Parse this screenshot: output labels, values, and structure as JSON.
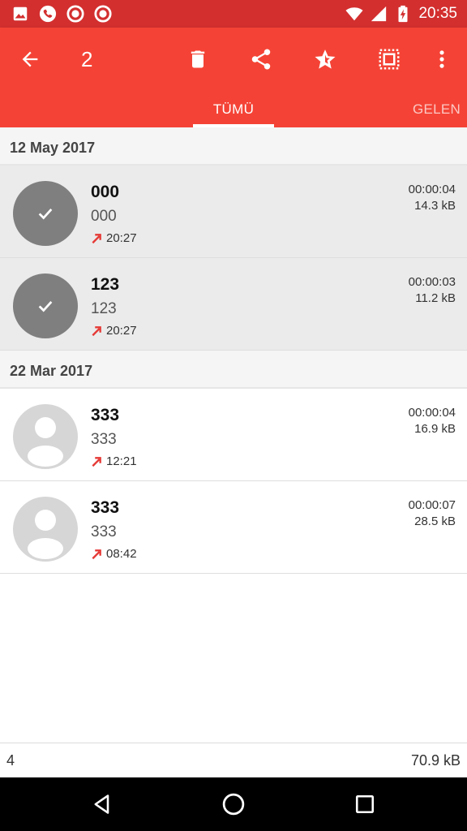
{
  "status_bar": {
    "time": "20:35",
    "left_icons": [
      "image-icon",
      "phone-call-icon",
      "record-icon",
      "record-icon"
    ],
    "right_icons": [
      "wifi-icon",
      "signal-icon",
      "battery-charging-icon"
    ]
  },
  "toolbar": {
    "selected_count": "2",
    "actions": [
      "back-arrow-icon",
      "delete-icon",
      "share-icon",
      "star-icon",
      "select-all-icon",
      "more-vert-icon"
    ],
    "tabs": [
      {
        "label": "TÜMÜ",
        "active": true
      },
      {
        "label": "GELEN",
        "active": false
      }
    ],
    "color": "#f44336",
    "status_color": "#d32f2f"
  },
  "sections": [
    {
      "date": "12 May 2017",
      "items": [
        {
          "name": "000",
          "number": "000",
          "time": "20:27",
          "duration": "00:00:04",
          "size": "14.3 kB",
          "selected": true,
          "direction": "outgoing"
        },
        {
          "name": "123",
          "number": "123",
          "time": "20:27",
          "duration": "00:00:03",
          "size": "11.2 kB",
          "selected": true,
          "direction": "outgoing"
        }
      ]
    },
    {
      "date": "22 Mar 2017",
      "items": [
        {
          "name": "333",
          "number": "333",
          "time": "12:21",
          "duration": "00:00:04",
          "size": "16.9 kB",
          "selected": false,
          "direction": "outgoing"
        },
        {
          "name": "333",
          "number": "333",
          "time": "08:42",
          "duration": "00:00:07",
          "size": "28.5 kB",
          "selected": false,
          "direction": "outgoing"
        }
      ]
    }
  ],
  "summary": {
    "count": "4",
    "total_size": "70.9 kB"
  },
  "nav_bar": {
    "buttons": [
      "back-triangle-icon",
      "home-circle-icon",
      "recents-square-icon"
    ]
  }
}
